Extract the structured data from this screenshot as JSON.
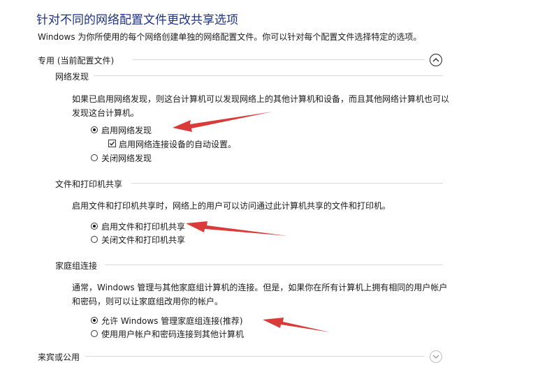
{
  "page": {
    "title": "针对不同的网络配置文件更改共享选项",
    "description": "Windows 为你所使用的每个网络创建单独的网络配置文件。你可以针对每个配置文件选择特定的选项。"
  },
  "profiles": [
    {
      "label": "专用 (当前配置文件)",
      "icon": "chevron-up-icon"
    },
    {
      "label": "来宾或公用",
      "icon": "chevron-down-icon"
    }
  ],
  "network_discovery": {
    "heading": "网络发现",
    "desc": "如果已启用网络发现，则这台计算机可以发现网络上的其他计算机和设备，而且其他网络计算机也可以发现这台计算机。",
    "option_on": "启用网络发现",
    "option_auto": "启用网络连接设备的自动设置。",
    "option_off": "关闭网络发现"
  },
  "file_printer_sharing": {
    "heading": "文件和打印机共享",
    "desc": "启用文件和打印机共享时，网络上的用户可以访问通过此计算机共享的文件和打印机。",
    "option_on": "启用文件和打印机共享",
    "option_off": "关闭文件和打印机共享"
  },
  "homegroup": {
    "heading": "家庭组连接",
    "desc": "通常，Windows 管理与其他家庭组计算机的连接。但是，如果你在所有计算机上拥有相同的用户帐户和密码，则可以让家庭组改用你的帐户。",
    "option_windows": "允许 Windows 管理家庭组连接(推荐)",
    "option_user": "使用用户帐户和密码连接到其他计算机"
  },
  "states": {
    "network_discovery_on": true,
    "auto_setup_checked": true,
    "file_sharing_on": true,
    "homegroup_windows_managed": true
  },
  "colors": {
    "title": "#1e3287",
    "annotation_arrow": "#d93a3a"
  }
}
